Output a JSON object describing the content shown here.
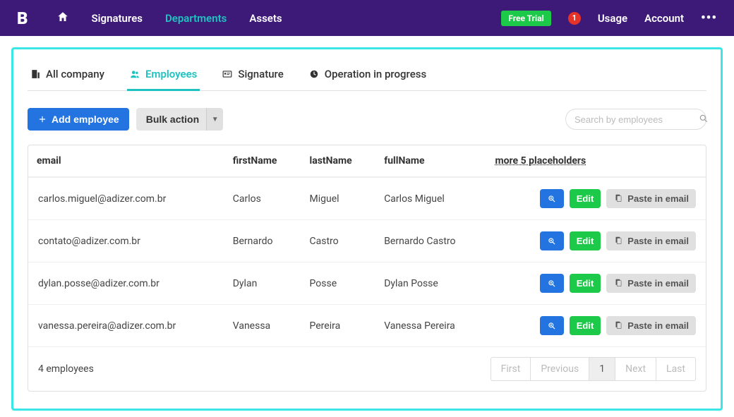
{
  "brand": "B",
  "nav": {
    "home": "",
    "signatures": "Signatures",
    "departments": "Departments",
    "assets": "Assets",
    "free_trial": "Free Trial",
    "notif_count": "1",
    "usage": "Usage",
    "account": "Account"
  },
  "tabs": {
    "all_company": "All company",
    "employees": "Employees",
    "signature": "Signature",
    "operation": "Operation in progress"
  },
  "toolbar": {
    "add_employee": "Add employee",
    "bulk_action": "Bulk action"
  },
  "search": {
    "placeholder": "Search by employees"
  },
  "columns": {
    "email": "email",
    "firstName": "firstName",
    "lastName": "lastName",
    "fullName": "fullName",
    "more": "more 5 placeholders"
  },
  "actions": {
    "edit": "Edit",
    "paste": "Paste in email"
  },
  "rows": [
    {
      "email": "carlos.miguel@adizer.com.br",
      "firstName": "Carlos",
      "lastName": "Miguel",
      "fullName": "Carlos Miguel"
    },
    {
      "email": "contato@adizer.com.br",
      "firstName": "Bernardo",
      "lastName": "Castro",
      "fullName": "Bernardo Castro"
    },
    {
      "email": "dylan.posse@adizer.com.br",
      "firstName": "Dylan",
      "lastName": "Posse",
      "fullName": "Dylan Posse"
    },
    {
      "email": "vanessa.pereira@adizer.com.br",
      "firstName": "Vanessa",
      "lastName": "Pereira",
      "fullName": "Vanessa Pereira"
    }
  ],
  "footer": {
    "count": "4 employees"
  },
  "pagination": {
    "first": "First",
    "previous": "Previous",
    "page": "1",
    "next": "Next",
    "last": "Last"
  }
}
